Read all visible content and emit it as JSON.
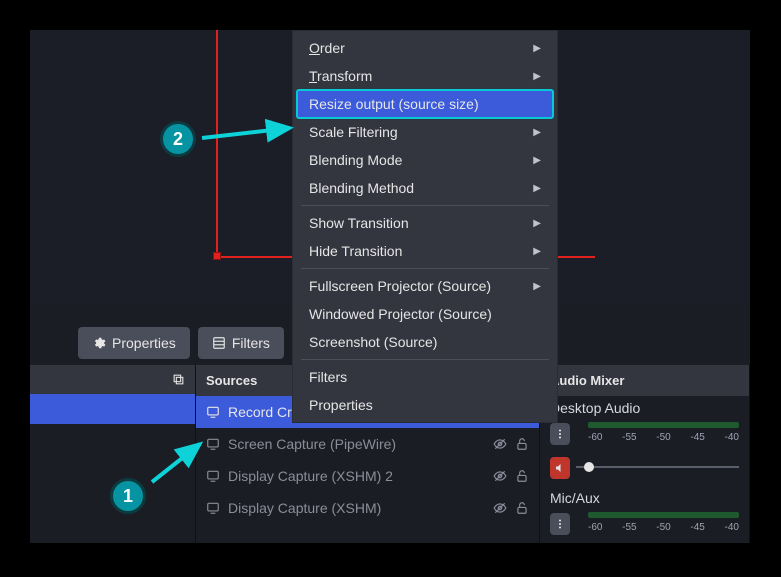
{
  "toolbar": {
    "properties_label": "Properties",
    "filters_label": "Filters"
  },
  "dock": {
    "sources_title": "Sources",
    "mixer_title": "Audio Mixer",
    "sources": [
      {
        "label": "Record Cropped Area",
        "selected": true
      },
      {
        "label": "Screen Capture (PipeWire)",
        "selected": false
      },
      {
        "label": "Display Capture (XSHM) 2",
        "selected": false
      },
      {
        "label": "Display Capture (XSHM)",
        "selected": false
      }
    ],
    "mixer": {
      "tracks": [
        {
          "label": "Desktop Audio"
        },
        {
          "label": "Mic/Aux"
        }
      ],
      "ticks": [
        "-60",
        "-55",
        "-50",
        "-45",
        "-40"
      ]
    }
  },
  "context_menu": [
    {
      "label": "Order",
      "underline": "O",
      "arrow": true
    },
    {
      "label": "Transform",
      "underline": "T",
      "arrow": true
    },
    {
      "label": "Resize output (source size)",
      "highlighted": true
    },
    {
      "label": "Scale Filtering",
      "arrow": true
    },
    {
      "label": "Blending Mode",
      "arrow": true
    },
    {
      "label": "Blending Method",
      "arrow": true
    },
    {
      "sep": true
    },
    {
      "label": "Show Transition",
      "arrow": true
    },
    {
      "label": "Hide Transition",
      "arrow": true
    },
    {
      "sep": true
    },
    {
      "label": "Fullscreen Projector (Source)",
      "arrow": true
    },
    {
      "label": "Windowed Projector (Source)"
    },
    {
      "label": "Screenshot (Source)"
    },
    {
      "sep": true
    },
    {
      "label": "Filters"
    },
    {
      "label": "Properties"
    }
  ],
  "annotations": {
    "one": "1",
    "two": "2"
  }
}
